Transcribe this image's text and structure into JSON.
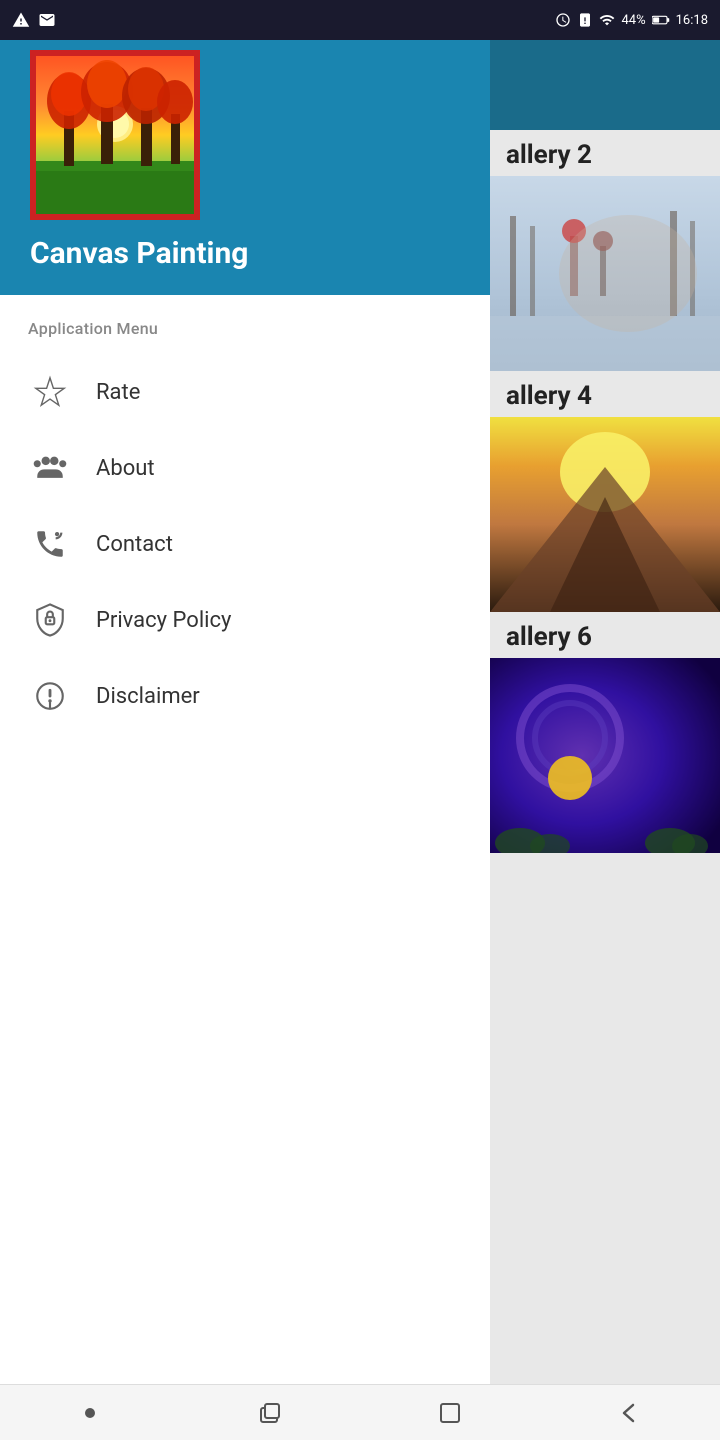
{
  "statusBar": {
    "battery": "44%",
    "time": "16:18",
    "batteryIcon": "battery-icon",
    "alarmIcon": "alarm-icon",
    "signalIcon": "signal-icon"
  },
  "drawer": {
    "appName": "Canvas Painting",
    "logoAlt": "canvas-painting-logo",
    "sectionLabel": "Application Menu",
    "menuItems": [
      {
        "id": "rate",
        "label": "Rate",
        "icon": "star-icon"
      },
      {
        "id": "about",
        "label": "About",
        "icon": "people-icon"
      },
      {
        "id": "contact",
        "label": "Contact",
        "icon": "contact-icon"
      },
      {
        "id": "privacy",
        "label": "Privacy Policy",
        "icon": "shield-icon"
      },
      {
        "id": "disclaimer",
        "label": "Disclaimer",
        "icon": "info-icon"
      }
    ]
  },
  "gallery": {
    "items": [
      {
        "id": "gallery2",
        "title": "allery 2"
      },
      {
        "id": "gallery4",
        "title": "allery 4"
      },
      {
        "id": "gallery6",
        "title": "allery 6"
      }
    ]
  },
  "bottomNav": {
    "home": "home-button",
    "recent": "recent-button",
    "back": "back-button",
    "dot": "menu-dot-button"
  }
}
